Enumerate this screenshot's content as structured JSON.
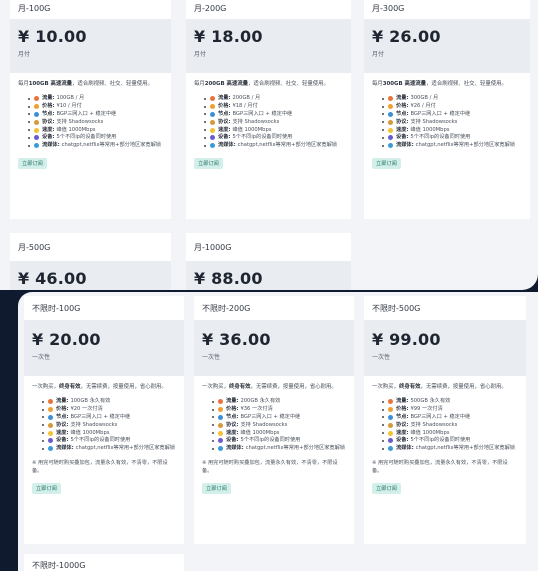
{
  "monthly": {
    "cards": [
      {
        "title": "月-100G",
        "price": "¥ 10.00",
        "period": "月付",
        "desc_pre": "每月",
        "desc_bold": "100GB 高速流量",
        "desc_post": "，适合刷视频、社交、轻量使用。",
        "features": [
          {
            "k": "流量:",
            "v": "100GB / 月"
          },
          {
            "k": "价格:",
            "v": "¥10 / 月付"
          },
          {
            "k": "节点:",
            "v": "BGP三网入口 + 稳定中继"
          },
          {
            "k": "协议:",
            "v": "支持 Shadowsocks"
          },
          {
            "k": "速度:",
            "v": "峰值 1000Mbps"
          },
          {
            "k": "设备:",
            "v": "5个不同ip的设备同时使用"
          },
          {
            "k": "流媒体:",
            "v": "chatgpt,netflix等常用+部分地区家宽解锁"
          }
        ],
        "button": "立即订阅"
      },
      {
        "title": "月-200G",
        "price": "¥ 18.00",
        "period": "月付",
        "desc_pre": "每月",
        "desc_bold": "200GB 高速流量",
        "desc_post": "，适合刷视频、社交、轻量使用。",
        "features": [
          {
            "k": "流量:",
            "v": "200GB / 月"
          },
          {
            "k": "价格:",
            "v": "¥18 / 月付"
          },
          {
            "k": "节点:",
            "v": "BGP三网入口 + 稳定中继"
          },
          {
            "k": "协议:",
            "v": "支持 Shadowsocks"
          },
          {
            "k": "速度:",
            "v": "峰值 1000Mbps"
          },
          {
            "k": "设备:",
            "v": "5个不同ip的设备同时使用"
          },
          {
            "k": "流媒体:",
            "v": "chatgpt,netflix等常用+部分地区家宽解锁"
          }
        ],
        "button": "立即订阅"
      },
      {
        "title": "月-300G",
        "price": "¥ 26.00",
        "period": "月付",
        "desc_pre": "每月",
        "desc_bold": "300GB 高速流量",
        "desc_post": "，适合刷视频、社交、轻量使用。",
        "features": [
          {
            "k": "流量:",
            "v": "300GB / 月"
          },
          {
            "k": "价格:",
            "v": "¥26 / 月付"
          },
          {
            "k": "节点:",
            "v": "BGP三网入口 + 稳定中继"
          },
          {
            "k": "协议:",
            "v": "支持 Shadowsocks"
          },
          {
            "k": "速度:",
            "v": "峰值 1000Mbps"
          },
          {
            "k": "设备:",
            "v": "5个不同ip的设备同时使用"
          },
          {
            "k": "流媒体:",
            "v": "chatgpt,netflix等常用+部分地区家宽解锁"
          }
        ],
        "button": "立即订阅"
      },
      {
        "title": "月-500G",
        "price": "¥ 46.00"
      },
      {
        "title": "月-1000G",
        "price": "¥ 88.00"
      }
    ]
  },
  "lifetime": {
    "cards": [
      {
        "title": "不限时-100G",
        "price": "¥ 20.00",
        "period": "一次性",
        "desc_pre": "一次购买，",
        "desc_bold": "终身有效",
        "desc_post": "，无需续费，按量使用，省心耐用。",
        "features": [
          {
            "k": "流量:",
            "v": "100GB 永久有效"
          },
          {
            "k": "价格:",
            "v": "¥20 一次付清"
          },
          {
            "k": "节点:",
            "v": "BGP三网入口 + 稳定中继"
          },
          {
            "k": "协议:",
            "v": "支持 Shadowsocks"
          },
          {
            "k": "速度:",
            "v": "峰值 1000Mbps"
          },
          {
            "k": "设备:",
            "v": "5个不同ip的设备同时使用"
          },
          {
            "k": "流媒体:",
            "v": "chatgpt,netflix等常用+部分地区家宽解锁"
          }
        ],
        "note": "※ 用完可随时购买叠加包，流量永久有效，不清零，不限设备。",
        "button": "立即订阅"
      },
      {
        "title": "不限时-200G",
        "price": "¥ 36.00",
        "period": "一次性",
        "desc_pre": "一次购买，",
        "desc_bold": "终身有效",
        "desc_post": "，无需续费，按量使用，省心耐用。",
        "features": [
          {
            "k": "流量:",
            "v": "200GB 永久有效"
          },
          {
            "k": "价格:",
            "v": "¥36 一次付清"
          },
          {
            "k": "节点:",
            "v": "BGP三网入口 + 稳定中继"
          },
          {
            "k": "协议:",
            "v": "支持 Shadowsocks"
          },
          {
            "k": "速度:",
            "v": "峰值 1000Mbps"
          },
          {
            "k": "设备:",
            "v": "5个不同ip的设备同时使用"
          },
          {
            "k": "流媒体:",
            "v": "chatgpt,netflix等常用+部分地区家宽解锁"
          }
        ],
        "note": "※ 用完可随时购买叠加包，流量永久有效，不清零，不限设备。",
        "button": "立即订阅"
      },
      {
        "title": "不限时-500G",
        "price": "¥ 99.00",
        "period": "一次性",
        "desc_pre": "一次购买，",
        "desc_bold": "终身有效",
        "desc_post": "，无需续费，按量使用，省心耐用。",
        "features": [
          {
            "k": "流量:",
            "v": "500GB 永久有效"
          },
          {
            "k": "价格:",
            "v": "¥99 一次付清"
          },
          {
            "k": "节点:",
            "v": "BGP三网入口 + 稳定中继"
          },
          {
            "k": "协议:",
            "v": "支持 Shadowsocks"
          },
          {
            "k": "速度:",
            "v": "峰值 1000Mbps"
          },
          {
            "k": "设备:",
            "v": "5个不同ip的设备同时使用"
          },
          {
            "k": "流媒体:",
            "v": "chatgpt,netflix等常用+部分地区家宽解锁"
          }
        ],
        "note": "※ 用完可随时购买叠加包，流量永久有效，不清零，不限设备。",
        "button": "立即订阅"
      },
      {
        "title": "不限时-1000G"
      }
    ]
  },
  "feature_icons": [
    {
      "name": "traffic-icon",
      "color": "#e8743b"
    },
    {
      "name": "price-icon",
      "color": "#f0a030"
    },
    {
      "name": "node-icon",
      "color": "#3a8fd8"
    },
    {
      "name": "protocol-icon",
      "color": "#d49a3a"
    },
    {
      "name": "speed-icon",
      "color": "#f2c230"
    },
    {
      "name": "device-icon",
      "color": "#6b5bd0"
    },
    {
      "name": "streaming-icon",
      "color": "#3b9bd8"
    }
  ],
  "colors": {
    "page_bg": "#f2f4f8",
    "outer_bg": "#0f1a2e",
    "card_bg": "#ffffff",
    "price_band": "#e9ecf0",
    "button_bg": "#d3efea",
    "button_text": "#1d6f63"
  }
}
